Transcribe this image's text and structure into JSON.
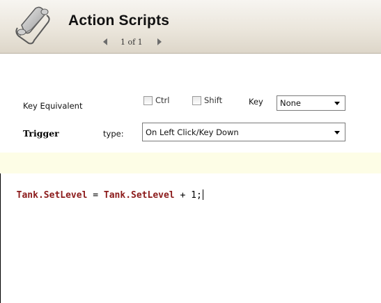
{
  "header": {
    "title": "Action Scripts",
    "icon": "scroll-icon",
    "pager_text": "1 of 1"
  },
  "key_equivalent": {
    "label": "Key Equivalent",
    "ctrl_label": "Ctrl",
    "ctrl_checked": false,
    "shift_label": "Shift",
    "shift_checked": false,
    "key_label": "Key",
    "key_value": "None"
  },
  "trigger": {
    "label": "Trigger",
    "type_label": "type:",
    "type_value": "On Left Click/Key Down"
  },
  "code": {
    "tokens": [
      {
        "text": "Tank.SetLevel",
        "kind": "ident"
      },
      {
        "text": " = ",
        "kind": "plain"
      },
      {
        "text": "Tank.SetLevel",
        "kind": "ident"
      },
      {
        "text": " + 1;",
        "kind": "plain"
      }
    ]
  },
  "colors": {
    "identifier": "#8b1a1a",
    "band": "#fdfde6",
    "header_top": "#f7f5f1",
    "header_bottom": "#ddd6c9"
  }
}
